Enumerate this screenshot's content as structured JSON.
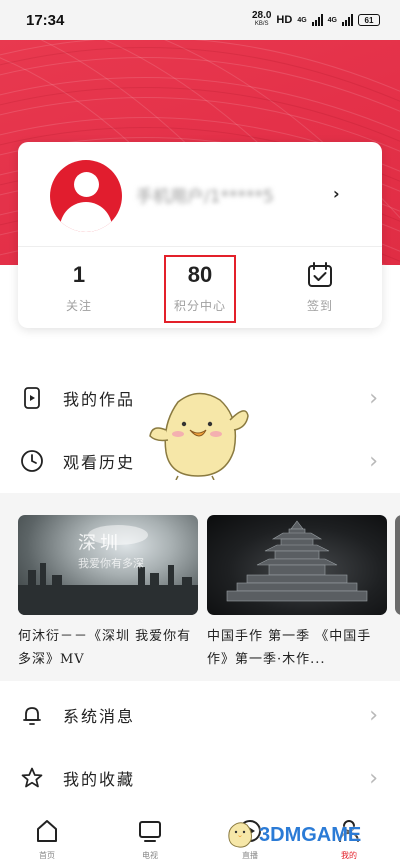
{
  "status_bar": {
    "time": "17:34",
    "net_speed": "28.0",
    "net_unit": "KB/S",
    "hd_label": "HD",
    "signal1": "4G",
    "signal2": "4G",
    "battery": "61"
  },
  "profile": {
    "name": "手机用户/1*****5"
  },
  "stats": [
    {
      "value": "1",
      "label": "关注"
    },
    {
      "value": "80",
      "label": "积分中心"
    },
    {
      "value": "",
      "label": "签到"
    }
  ],
  "menu": {
    "my_works": "我的作品",
    "watch_history": "观看历史",
    "system_messages": "系统消息",
    "my_favorites": "我的收藏"
  },
  "videos": [
    {
      "title": "何沐衍－－《深圳 我爱你有多深》MV",
      "overlay": "深圳",
      "overlay_sub": "我爱你有多深"
    },
    {
      "title": "中国手作 第一季 《中国手作》第一季·木作..."
    }
  ],
  "bottom_nav": [
    {
      "label": "首页",
      "icon": "home-icon"
    },
    {
      "label": "电视",
      "icon": "tv-icon"
    },
    {
      "label": "直播",
      "icon": "live-icon"
    },
    {
      "label": "我的",
      "icon": "profile-icon"
    }
  ],
  "watermark": "3DMGAME",
  "colors": {
    "brand_red": "#e43149",
    "highlight": "#e3202a"
  }
}
